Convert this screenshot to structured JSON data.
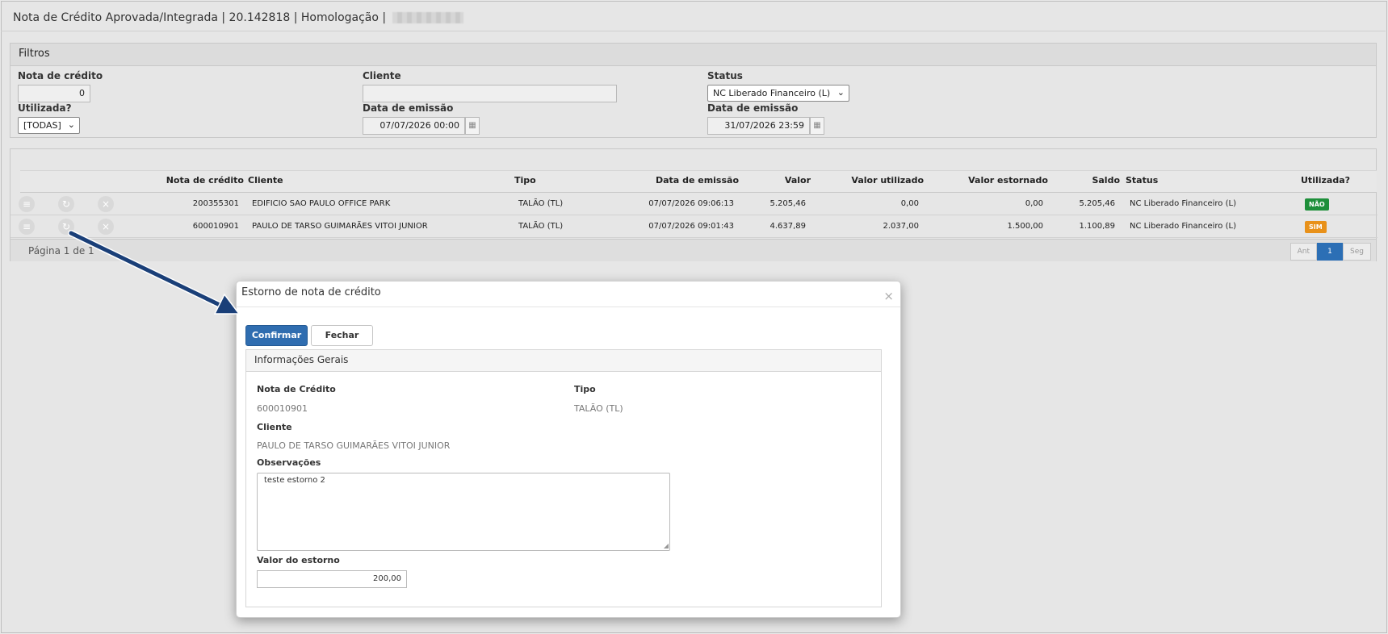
{
  "page": {
    "title": "Nota de Crédito Aprovada/Integrada | 20.142818 | Homologação |"
  },
  "filters": {
    "header": "Filtros",
    "nota_credito": {
      "label": "Nota de crédito",
      "value": "0"
    },
    "cliente": {
      "label": "Cliente",
      "value": ""
    },
    "status": {
      "label": "Status",
      "value": "NC Liberado Financeiro (L)"
    },
    "utilizada": {
      "label": "Utilizada?",
      "value": "[TODAS]"
    },
    "data_emissao_de": {
      "label": "Data de emissão",
      "value": "07/07/2026 00:00"
    },
    "data_emissao_ate": {
      "label": "Data de emissão",
      "value": "31/07/2026 23:59"
    }
  },
  "grid": {
    "columns": [
      "Nota de crédito",
      "Cliente",
      "Tipo",
      "Data de emissão",
      "Valor",
      "Valor utilizado",
      "Valor estornado",
      "Saldo",
      "Status",
      "Utilizada?"
    ],
    "rows": [
      {
        "nota": "200355301",
        "cliente": "EDIFICIO SAO PAULO OFFICE PARK",
        "tipo": "TALÃO (TL)",
        "data": "07/07/2026 09:06:13",
        "valor": "5.205,46",
        "utilizado": "0,00",
        "estornado": "0,00",
        "saldo": "5.205,46",
        "status": "NC Liberado Financeiro (L)",
        "utilizada": "NÃO"
      },
      {
        "nota": "600010901",
        "cliente": "PAULO DE TARSO GUIMARÃES VITOI JUNIOR",
        "tipo": "TALÃO (TL)",
        "data": "07/07/2026 09:01:43",
        "valor": "4.637,89",
        "utilizado": "2.037,00",
        "estornado": "1.500,00",
        "saldo": "1.100,89",
        "status": "NC Liberado Financeiro (L)",
        "utilizada": "SIM"
      }
    ],
    "pagination": {
      "text": "Página 1 de 1",
      "prev": "Ant",
      "current": "1",
      "next": "Seg"
    }
  },
  "modal": {
    "title": "Estorno de nota de crédito",
    "close": "×",
    "confirm_label": "Confirmar",
    "close_label": "Fechar",
    "panel_title": "Informações Gerais",
    "nota_label": "Nota de Crédito",
    "nota_value": "600010901",
    "tipo_label": "Tipo",
    "tipo_value": "TALÃO (TL)",
    "cliente_label": "Cliente",
    "cliente_value": "PAULO DE TARSO GUIMARÃES VITOI JUNIOR",
    "obs_label": "Observações",
    "obs_value": "teste estorno 2",
    "valor_label": "Valor do estorno",
    "valor_value": "200,00"
  },
  "icons": {
    "row_actions": [
      "menu-icon",
      "refund-icon",
      "cancel-icon"
    ],
    "calendar": "calendar-icon",
    "select": "chevron-down-icon"
  },
  "colors": {
    "badge_nao": "#1e8f3a",
    "badge_sim": "#e8911a",
    "primary": "#2f6db0",
    "arrow": "#1a3f78"
  }
}
